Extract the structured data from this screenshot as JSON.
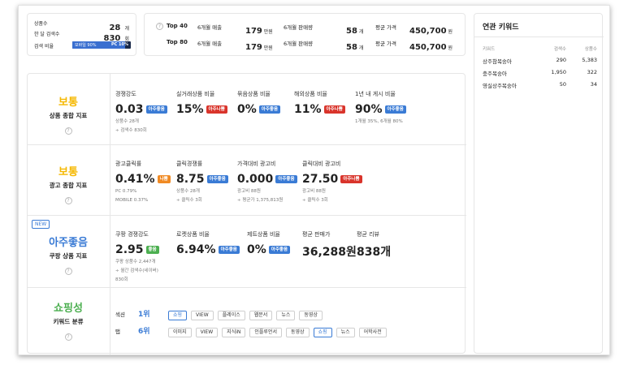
{
  "summary": {
    "products_label": "상품수",
    "products_value": "28",
    "products_unit": "개",
    "monthly_search_label": "한 달 검색수",
    "monthly_search_value": "830",
    "monthly_search_unit": "회",
    "search_ratio_label": "검색 비율",
    "mobile_ratio": "모바일 90%",
    "pc_ratio": "PC 10%",
    "mobile_fraction": 0.9
  },
  "top": [
    {
      "rank": "Top 40",
      "sales_label": "6개월 매출",
      "sales_value": "179",
      "sales_unit": "만원",
      "qty_label": "6개월 판매량",
      "qty_value": "58",
      "qty_unit": "개",
      "price_label": "평균 가격",
      "price_value": "450,700",
      "price_unit": "원"
    },
    {
      "rank": "Top 80",
      "sales_label": "6개월 매출",
      "sales_value": "179",
      "sales_unit": "만원",
      "qty_label": "6개월 판매량",
      "qty_value": "58",
      "qty_unit": "개",
      "price_label": "평균 가격",
      "price_value": "450,700",
      "price_unit": "원"
    }
  ],
  "product_index": {
    "grade": "보통",
    "grade_color": "#f5b800",
    "title": "상품 종합 지표",
    "metrics": [
      {
        "label": "경쟁강도",
        "value": "0.03",
        "badge": "아주좋음",
        "sub1": "상품수 28개",
        "sub2": "÷ 검색수 830회"
      },
      {
        "label": "실거래상품 비율",
        "value": "15%",
        "badge": "아주나쁨"
      },
      {
        "label": "묶음상품 비율",
        "value": "0%",
        "badge": "아주좋음"
      },
      {
        "label": "해외상품 비율",
        "value": "11%",
        "badge": "아주나쁨"
      },
      {
        "label": "1년 내 게시 비율",
        "value": "90%",
        "badge": "아주좋음",
        "sub1": "1개월 35%, 6개월 80%"
      }
    ]
  },
  "ad_index": {
    "grade": "보통",
    "grade_color": "#f5b800",
    "title": "광고 종합 지표",
    "metrics": [
      {
        "label": "광고클릭률",
        "value": "0.41%",
        "badge": "나쁨",
        "sub1": "PC 0.79%",
        "sub2": "MOBILE 0.37%"
      },
      {
        "label": "클릭경쟁률",
        "value": "8.75",
        "badge": "아주좋음",
        "sub1": "상품수 28개",
        "sub2": "÷ 클릭수 3회"
      },
      {
        "label": "가격대비 광고비",
        "value": "0.000",
        "badge": "아주좋음",
        "sub1": "광고비 88원",
        "sub2": "÷ 평균가 1,375,813원"
      },
      {
        "label": "클릭대비 광고비",
        "value": "27.50",
        "badge": "아주나쁨",
        "sub1": "광고비 88원",
        "sub2": "÷ 클릭수 3회"
      }
    ]
  },
  "coupang_index": {
    "new_label": "NEW",
    "grade": "아주좋음",
    "grade_color": "#3a7bd5",
    "title": "쿠팡 상품 지표",
    "metrics": [
      {
        "label": "쿠팡 경쟁강도",
        "value": "2.95",
        "badge": "좋음",
        "sub1": "쿠팡 상품수 2,447개",
        "sub2": "÷ 월간 검색수(네이버)",
        "sub3": "830회"
      },
      {
        "label": "로켓상품 비율",
        "value": "6.94%",
        "badge": "아주좋음"
      },
      {
        "label": "제트상품 비율",
        "value": "0%",
        "badge": "아주좋음"
      },
      {
        "label": "평균 판매가",
        "value": "36,288원"
      },
      {
        "label": "평균 리뷰",
        "value": "838개"
      }
    ]
  },
  "shopping": {
    "grade": "쇼핑성",
    "grade_color": "#4caf50",
    "title": "키워드 분류",
    "section_label": "섹션",
    "section_rank": "1위",
    "section_chips": [
      "쇼핑",
      "VIEW",
      "플레이스",
      "웹문서",
      "뉴스",
      "동영상"
    ],
    "tab_label": "탭",
    "tab_rank": "6위",
    "tab_chips": [
      "이미지",
      "VIEW",
      "지식iN",
      "인플루언서",
      "동영상",
      "쇼핑",
      "뉴스",
      "어학사전"
    ]
  },
  "related": {
    "title": "연관 키워드",
    "headers": [
      "키워드",
      "검색수",
      "상품수"
    ],
    "rows": [
      [
        "상주참복숭아",
        "290",
        "5,383"
      ],
      [
        "충주복숭아",
        "1,950",
        "322"
      ],
      [
        "영실상주복숭아",
        "50",
        "34"
      ]
    ]
  }
}
